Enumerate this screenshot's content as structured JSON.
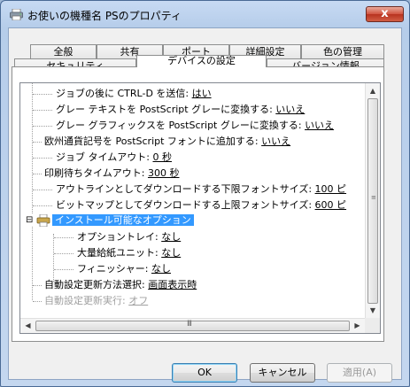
{
  "window": {
    "title": "お使いの機種名 PSのプロパティ",
    "close_glyph": "x"
  },
  "tabs": {
    "row1": [
      "全般",
      "共有",
      "ポート",
      "詳細設定",
      "色の管理"
    ],
    "row2": [
      "セキュリティ",
      "デバイスの設定",
      "バージョン情報"
    ],
    "active": "デバイスの設定"
  },
  "tree": {
    "items": [
      {
        "label": "ジョブの後に CTRL-D を送信: ",
        "value": "はい"
      },
      {
        "label": "グレー テキストを PostScript グレーに変換する: ",
        "value": "いいえ"
      },
      {
        "label": "グレー グラフィックスを PostScript グレーに変換する: ",
        "value": "いいえ"
      },
      {
        "label": "欧州通貨記号を PostScript フォントに追加する: ",
        "value": "いいえ"
      },
      {
        "label": "ジョブ タイムアウト: ",
        "value": "0 秒"
      },
      {
        "label": "印刷待ちタイムアウト: ",
        "value": "300 秒"
      },
      {
        "label": "アウトラインとしてダウンロードする下限フォントサイズ: ",
        "value": "100 ピ"
      },
      {
        "label": "ビットマップとしてダウンロードする上限フォントサイズ: ",
        "value": "600 ピ"
      },
      {
        "label": "インストール可能なオプション",
        "value": ""
      },
      {
        "label": "オプショントレイ: ",
        "value": "なし"
      },
      {
        "label": "大量給紙ユニット: ",
        "value": "なし"
      },
      {
        "label": "フィニッシャー: ",
        "value": "なし"
      },
      {
        "label": "自動設定更新方法選択: ",
        "value": "画面表示時"
      },
      {
        "label": "自動設定更新実行: ",
        "value": "オフ"
      }
    ],
    "expander": "⊟",
    "hscroll_grip": "III"
  },
  "buttons": {
    "ok": "OK",
    "cancel": "キャンセル",
    "apply": "適用(A)"
  },
  "colors": {
    "selection": "#3399ff",
    "titlebar": "#b9d1ea",
    "close": "#c7432c"
  }
}
